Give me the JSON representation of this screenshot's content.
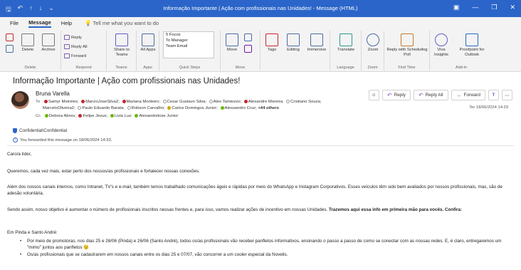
{
  "window": {
    "title": "Informação Importante | Ação com profissionais nas Unidades!  -  Message (HTML)"
  },
  "menu": {
    "file": "File",
    "message": "Message",
    "help": "Help",
    "tellme": "Tell me what you want to do"
  },
  "ribbon": {
    "delete_group": {
      "delete": "Delete",
      "archive": "Archive",
      "label": "Delete"
    },
    "respond_group": {
      "reply": "Reply",
      "reply_all": "Reply All",
      "forward": "Forward",
      "label": "Respond"
    },
    "teams_group": {
      "share": "Share to Teams",
      "label": "Teams"
    },
    "apps_group": {
      "all_apps": "All Apps",
      "label": "Apps"
    },
    "quicksteps_group": {
      "items": [
        "5 Focos",
        "To Manager",
        "Team Email"
      ],
      "label": "Quick Steps"
    },
    "move_group": {
      "move": "Move",
      "label": "Move"
    },
    "tags": "Tags",
    "editing": "Editing",
    "immersive": "Immersive",
    "language_group": {
      "translate": "Translate",
      "label": "Language"
    },
    "zoom_group": {
      "zoom": "Zoom",
      "label": "Zoom"
    },
    "findtime_group": {
      "reply_poll": "Reply with Scheduling Poll",
      "label": "Find Time"
    },
    "addin_group": {
      "viva": "Viva Insights",
      "proofpoint": "Proofpoint for Outlook",
      "label": "Add-in"
    }
  },
  "message": {
    "subject": "Informação Importante | Ação com profissionais nas Unidades!",
    "sender": "Bruna Varella",
    "to_label": "To",
    "to_line1": [
      {
        "status": "red",
        "name": "Samyr Meireles;"
      },
      {
        "status": "red",
        "name": "MarcioJoseSilva2;"
      },
      {
        "status": "red",
        "name": "Mariana Monteiro;"
      },
      {
        "status": "empty",
        "name": "Cesar Gustavo Silva;"
      },
      {
        "status": "empty",
        "name": "Alex Tamiozzo;"
      },
      {
        "status": "red",
        "name": "Alexandre Moreira;"
      },
      {
        "status": "empty",
        "name": "Cristiano Souza;"
      }
    ],
    "to_line2": [
      {
        "status": "none",
        "name": "MarceloOliveira2;"
      },
      {
        "status": "empty",
        "name": "Paulo Eduardo Barata;"
      },
      {
        "status": "empty",
        "name": "Robson Carvalho;"
      },
      {
        "status": "yellow",
        "name": "Carlos Domingos Junior;"
      },
      {
        "status": "green",
        "name": "Alessandro Cruz;"
      }
    ],
    "more_recipients": "+44 others",
    "cc_label": "Cc",
    "cc": [
      {
        "status": "green",
        "name": "Debora Abreu;"
      },
      {
        "status": "red",
        "name": "Felipe Jesus;"
      },
      {
        "status": "green",
        "name": "Livia Luz;"
      },
      {
        "status": "green",
        "name": "Alexandrelose Junior"
      }
    ],
    "actions": {
      "reply": "Reply",
      "reply_all": "Reply All",
      "forward": "Forward"
    },
    "date": "Ter 18/06/2024 14:29",
    "sensitivity": "Confidential\\Confidential",
    "forward_info": "You forwarded this message on 18/06/2024 14:33."
  },
  "body": {
    "greeting": "Caro/a líder,",
    "p1": "Queremos, cada vez mais, estar perto dos nossos/as profissionais e fortalecer nossas conexões.",
    "p2": "Além dos nossos canais internos, como Intranet, TV's e e-mail, também temos trabalhado comunicações ágeis e rápidas por meio do WhatsApp e Instagram Corporativos. Esses veículos têm sido bem avaliados por nossos profissionais, mas, são de adesão voluntária.",
    "p3_normal": "Sendo assim, nosso objetivo é aumentar o número de profissionais inscritos nessas frentes e, para isso, vamos realizar ações de incentivo em nossas Unidades. ",
    "p3_bold": "Trazemos aqui essa info em primeira mão para vocês. Confira:",
    "section": "Em Pinda e Santo André:",
    "bullet1": "Por meio de promotoras, nos dias 25 e 26/06 (Pinda) e 26/06 (Santo André), todos os/as profissionais vão receber panfletos informativos, ensinando o passo a passo de como se conectar com as nossas redes. E, é claro, entregaremos um \"mimo\" juntos aos panfletos 😉",
    "bullet2": "Os/as profissionais que se cadastrarem em nossos canais entre os dias 25 e 07/07, vão concorrer a um cooler especial da Novelis."
  }
}
